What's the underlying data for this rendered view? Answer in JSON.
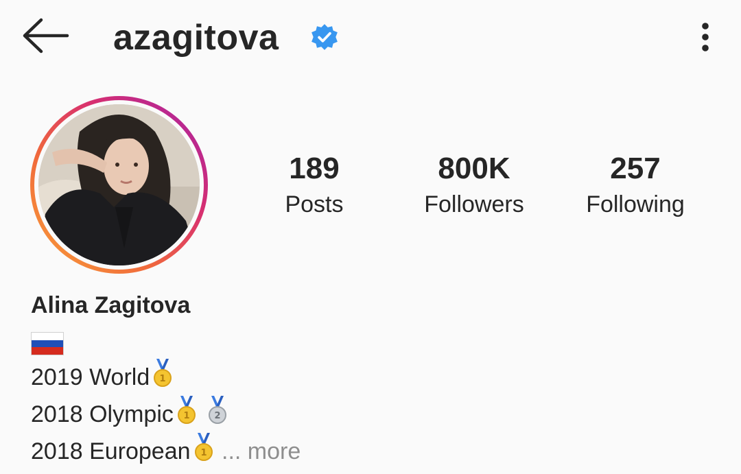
{
  "header": {
    "username": "azagitova",
    "back_icon": "back-arrow-icon",
    "verified_icon": "verified-badge-icon",
    "menu_icon": "more-vertical-icon"
  },
  "avatar": {
    "icon": "profile-photo"
  },
  "stats": {
    "posts": {
      "value": "189",
      "label": "Posts"
    },
    "followers": {
      "value": "800K",
      "label": "Followers"
    },
    "following": {
      "value": "257",
      "label": "Following"
    }
  },
  "bio": {
    "name": "Alina Zagitova",
    "flag_icon": "russia-flag-icon",
    "lines": [
      {
        "text": "2019 World",
        "medals": [
          "gold"
        ]
      },
      {
        "text": "2018 Olympic",
        "medals": [
          "gold",
          "silver"
        ]
      },
      {
        "text": "2018 European",
        "medals": [
          "gold"
        ]
      }
    ],
    "more_ellipsis": "...",
    "more_label": "more"
  },
  "colors": {
    "verified_blue": "#3897f0",
    "text": "#262626",
    "muted": "#8e8e8e",
    "story_ring_start": "#f9a23a",
    "story_ring_end": "#a321a8"
  }
}
